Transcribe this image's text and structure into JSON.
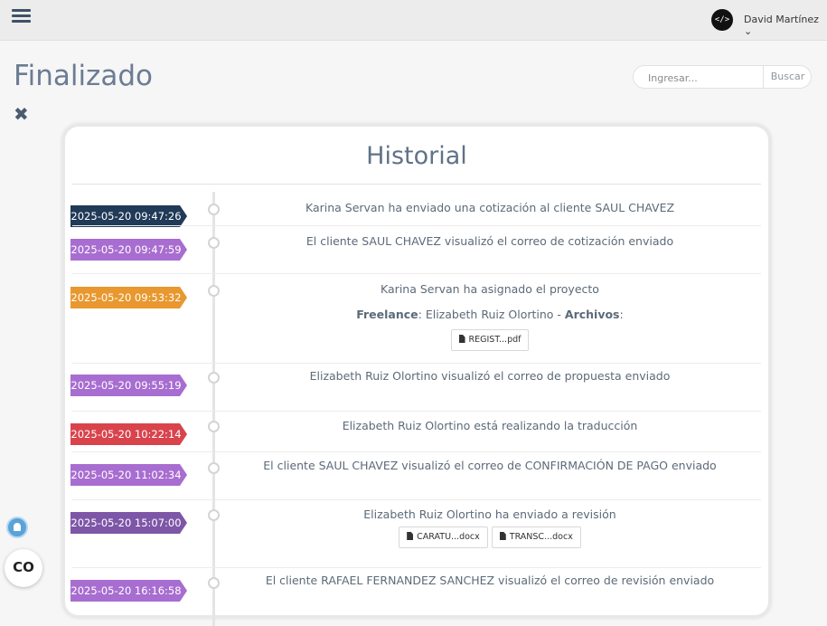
{
  "header": {
    "menu_icon": "hamburger-menu-icon",
    "avatar_glyph": "</>",
    "user_name": "David Martínez ⌄"
  },
  "page": {
    "title": "Finalizado",
    "close_glyph": "✖"
  },
  "search": {
    "placeholder": "Ingresar...",
    "button_label": "Buscar"
  },
  "panel": {
    "title": "Historial"
  },
  "colors": {
    "navy": "#203a57",
    "purple": "#a86dd0",
    "orange": "#e8982e",
    "red": "#d9444c",
    "violet": "#7e56a8"
  },
  "events": [
    {
      "date": "2025-05-20 09:47:26",
      "color": "#203a57",
      "message": "Karina Servan ha enviado una cotización al cliente SAUL CHAVEZ"
    },
    {
      "date": "2025-05-20 09:47:59",
      "color": "#a86dd0",
      "message": "El cliente SAUL CHAVEZ visualizó el correo de cotización enviado"
    },
    {
      "date": "2025-05-20 09:53:32",
      "color": "#e8982e",
      "message": "Karina Servan ha asignado el proyecto",
      "meta_label1": "Freelance",
      "meta_value": ": Elizabeth Ruiz Olortino - ",
      "meta_label2": "Archivos",
      "meta_tail": ":",
      "files": [
        "REGIST...pdf"
      ]
    },
    {
      "date": "2025-05-20 09:55:19",
      "color": "#a86dd0",
      "message": "Elizabeth Ruiz Olortino visualizó el correo de propuesta enviado"
    },
    {
      "date": "2025-05-20 10:22:14",
      "color": "#d9444c",
      "message": "Elizabeth Ruiz Olortino está realizando la traducción"
    },
    {
      "date": "2025-05-20 11:02:34",
      "color": "#a86dd0",
      "message": "El cliente SAUL CHAVEZ visualizó el correo de CONFIRMACIÓN DE PAGO enviado"
    },
    {
      "date": "2025-05-20 15:07:00",
      "color": "#7e56a8",
      "message": "Elizabeth Ruiz Olortino ha enviado a revisión",
      "files": [
        "CARATU...docx",
        "TRANSC...docx"
      ]
    },
    {
      "date": "2025-05-20 16:16:58",
      "color": "#a86dd0",
      "message": "El cliente RAFAEL FERNANDEZ SANCHEZ visualizó el correo de revisión enviado"
    }
  ],
  "widgets": {
    "bell_icon": "notification-bell-icon",
    "chat_icon": "chat-link-icon",
    "chat_glyph": "CO"
  }
}
